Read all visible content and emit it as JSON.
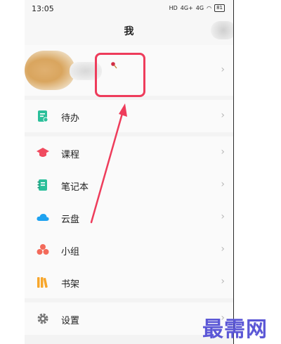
{
  "status_bar": {
    "time": "13:05",
    "net1": "4G+",
    "net2": "4G",
    "battery": "81"
  },
  "header": {
    "title": "我"
  },
  "menu": {
    "group1": [
      {
        "label": "待办",
        "icon": "todo-icon"
      }
    ],
    "group2": [
      {
        "label": "课程",
        "icon": "course-icon"
      },
      {
        "label": "笔记本",
        "icon": "notebook-icon"
      },
      {
        "label": "云盘",
        "icon": "cloud-icon"
      },
      {
        "label": "小组",
        "icon": "group-icon"
      },
      {
        "label": "书架",
        "icon": "bookshelf-icon"
      }
    ],
    "group3": [
      {
        "label": "设置",
        "icon": "gear-icon"
      }
    ]
  },
  "watermark": "最需网",
  "colors": {
    "accent": "#2bbf9a",
    "annotation": "#ee3c5b",
    "watermark": "#5b57d6"
  }
}
